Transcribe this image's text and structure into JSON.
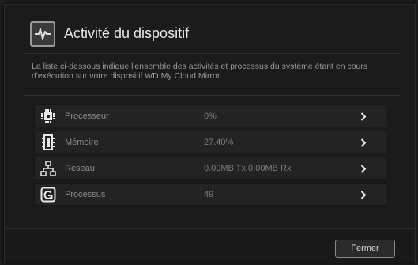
{
  "dialog": {
    "title": "Activité du dispositif",
    "title_icon": "activity-pulse-icon",
    "description": "La liste ci-dessous indique l'ensemble des activités et processus du système étant en cours d'exécution sur votre dispositif WD My Cloud Mirror.",
    "close_label": "Fermer"
  },
  "rows": [
    {
      "label": "Processeur",
      "value": "0%",
      "icon": "cpu-chip-icon"
    },
    {
      "label": "Mémoire",
      "value": "27.40%",
      "icon": "memory-module-icon"
    },
    {
      "label": "Réseau",
      "value": "0.00MB Tx,0.00MB Rx",
      "icon": "network-icon"
    },
    {
      "label": "Processus",
      "value": "49",
      "icon": "process-icon"
    }
  ],
  "colors": {
    "background": "#1b1b1b",
    "row_background": "#232323",
    "text_primary": "#e6e6e6",
    "text_muted": "#8a8a8a"
  }
}
